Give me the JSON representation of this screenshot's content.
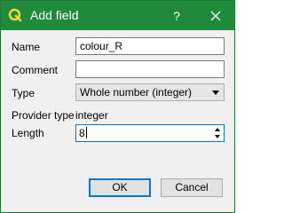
{
  "window": {
    "title": "Add field",
    "help_label": "?",
    "icon": "qgis-logo-icon",
    "colors": {
      "titlebar": "#1f8b3a",
      "focus": "#0078d7"
    }
  },
  "form": {
    "name": {
      "label": "Name",
      "value": "colour_R"
    },
    "comment": {
      "label": "Comment",
      "value": ""
    },
    "type": {
      "label": "Type",
      "selected": "Whole number (integer)"
    },
    "provider_type": {
      "label": "Provider type",
      "value": "integer"
    },
    "length": {
      "label": "Length",
      "value": "8"
    }
  },
  "buttons": {
    "ok": "OK",
    "cancel": "Cancel"
  }
}
